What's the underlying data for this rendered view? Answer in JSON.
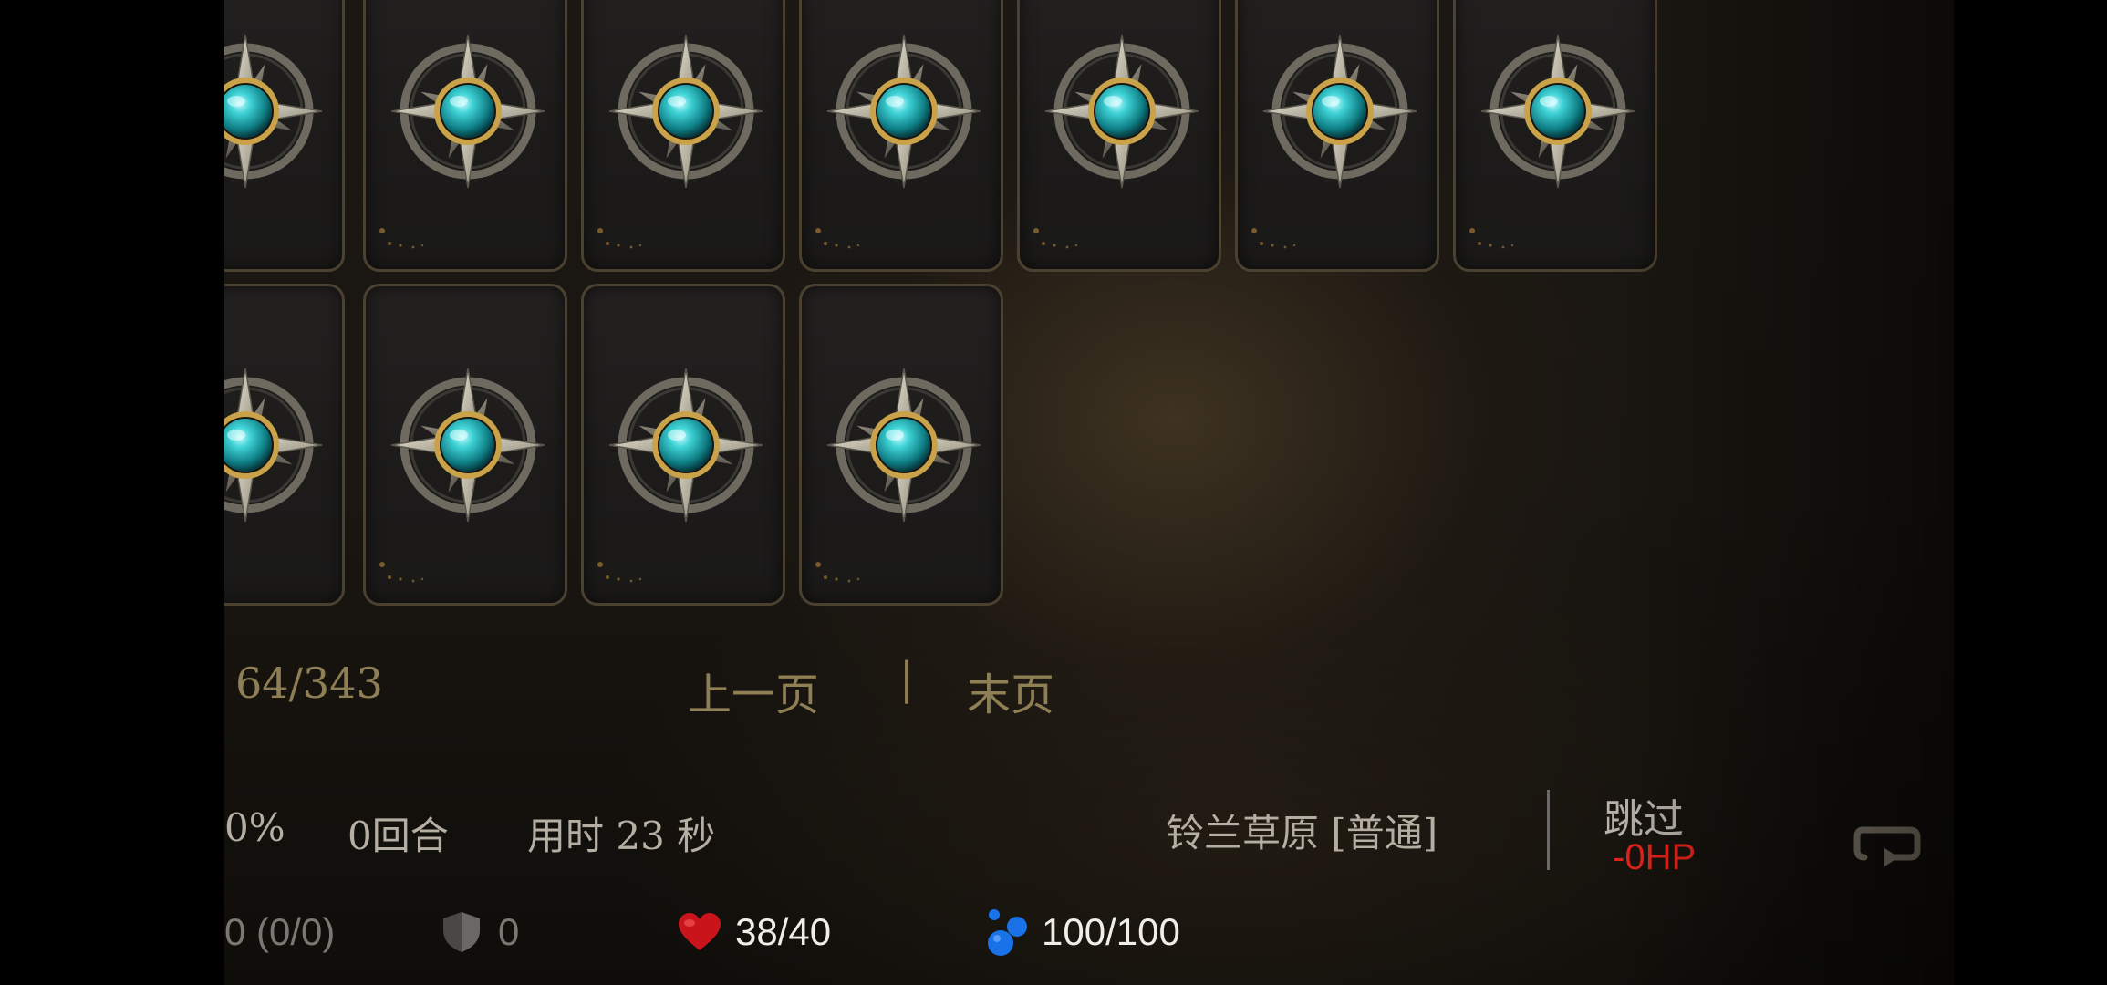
{
  "pagination": {
    "counter": "64/343",
    "prev_label": "上一页",
    "separator": "|",
    "last_label": "末页"
  },
  "status": {
    "progress": "0%",
    "turns": "0回合",
    "time_used": "用时 23 秒",
    "stage": "铃兰草原 [普通]",
    "skip_label": "跳过",
    "skip_cost": "-0HP"
  },
  "player": {
    "atk": "0 (0/0)",
    "shield": "0",
    "hp": "38/40",
    "mp": "100/100"
  },
  "cards": {
    "row1_count": 7,
    "row2_count": 4,
    "face": "face-down"
  },
  "colors": {
    "gold": "#8f7f55",
    "gem": "#2fc4c4",
    "hp_red": "#d01818",
    "mana_blue": "#1a72e8",
    "skip_cost": "#e0241b"
  },
  "icons": [
    "compass-star-emblem-icon",
    "shield-icon",
    "heart-icon",
    "mana-drops-icon",
    "back-icon"
  ]
}
